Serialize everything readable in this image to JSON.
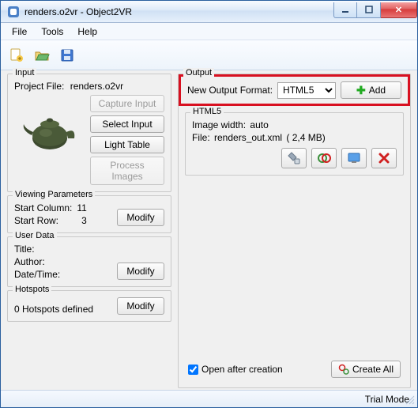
{
  "window": {
    "title": "renders.o2vr  - Object2VR",
    "min": "",
    "max": "",
    "close": "✕"
  },
  "menu": {
    "file": "File",
    "tools": "Tools",
    "help": "Help"
  },
  "input": {
    "group": "Input",
    "project_label": "Project File:",
    "project_value": "renders.o2vr",
    "capture": "Capture Input",
    "select": "Select Input",
    "light": "Light Table",
    "process": "Process Images"
  },
  "viewing": {
    "group": "Viewing Parameters",
    "startcol_label": "Start Column:",
    "startcol_value": "11",
    "startrow_label": "Start Row:",
    "startrow_value": "3",
    "modify": "Modify"
  },
  "userdata": {
    "group": "User Data",
    "title_label": "Title:",
    "author_label": "Author:",
    "datetime_label": "Date/Time:",
    "modify": "Modify"
  },
  "hotspots": {
    "group": "Hotspots",
    "count_text": "0 Hotspots defined",
    "modify": "Modify"
  },
  "output": {
    "group": "Output",
    "format_label": "New Output Format:",
    "format_value": "HTML5",
    "add": "Add",
    "sub_title": "HTML5",
    "imgwidth_label": "Image width:",
    "imgwidth_value": "auto",
    "file_label": "File:",
    "file_name": "renders_out.xml",
    "file_size": "(      2,4 MB)",
    "open_after": "Open after creation",
    "create_all": "Create All"
  },
  "status": {
    "trial": "Trial Mode"
  }
}
